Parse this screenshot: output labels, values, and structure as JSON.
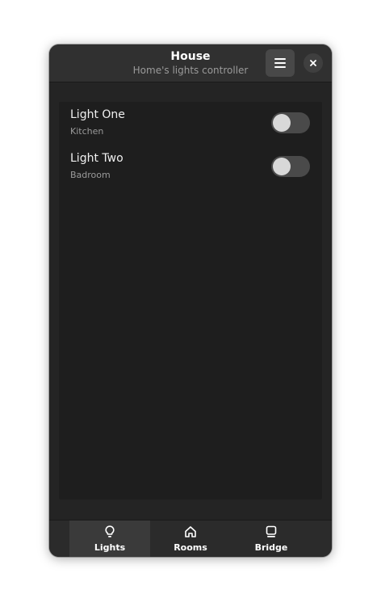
{
  "window": {
    "title": "House",
    "subtitle": "Home's lights controller"
  },
  "header": {
    "menu_icon": "hamburger-menu-icon",
    "close_icon": "close-icon"
  },
  "lights": [
    {
      "title": "Light One",
      "room": "Kitchen",
      "on": false
    },
    {
      "title": "Light Two",
      "room": "Badroom",
      "on": false
    }
  ],
  "view_switcher": {
    "active": "Lights",
    "tabs": [
      {
        "label": "Lights",
        "icon": "lightbulb-icon"
      },
      {
        "label": "Rooms",
        "icon": "house-icon"
      },
      {
        "label": "Bridge",
        "icon": "bridge-device-icon"
      }
    ]
  },
  "colors": {
    "window_bg": "#242424",
    "header_bg": "#303030",
    "list_bg": "#1e1e1e",
    "switch_off": "#4a4a4a",
    "active_tab": "#3a3a3a"
  }
}
